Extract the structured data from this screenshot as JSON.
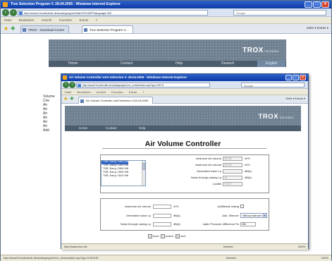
{
  "outer": {
    "title": "Trox Selection Program V. 28.04.2005 - Windows Internet Explorer",
    "address": "http://www2.troxtechnik.de/auslegung/en/StartYRV/APP/language=DE",
    "menu": [
      "Datei",
      "Bearbeiten",
      "Ansicht",
      "Favoriten",
      "Extras",
      "?"
    ],
    "tabs": [
      "TROX - Download Center",
      "Trox Selection Program V..."
    ],
    "toolbar_right": "Seite ▾  Extras ▾",
    "status_left": "http://www2.troxtechnik.de/auslegung/en/vvr_en/anwahle.asp?typ=VVR-E​/E",
    "status_zone": "Internet",
    "status_zoom": "100%"
  },
  "site": {
    "logo": "TROX",
    "logo_sub": "TECHNIK",
    "nav": [
      "Home",
      "Contact",
      "Help",
      "Deutsch",
      "English"
    ],
    "tree": [
      "Volume",
      "Cire",
      "Air",
      "Air",
      "Air",
      "Air",
      "Air",
      "Air",
      "Add"
    ]
  },
  "inner": {
    "title": "Air Volume Controller Unit Selection V. 28.04.2005 - Windows Internet Explorer",
    "address": "http://www2.troxtechnik.de/auslegung/en/vvr_en/selection.asp?typ=VVR-E",
    "menu": [
      "Datei",
      "Bearbeiten",
      "Ansicht",
      "Favoriten",
      "Extras",
      "?"
    ],
    "tab": "Air Volume Controller Unit Selection V.28.04.2005",
    "toolbar_right": "Seite ▾  Extras ▾",
    "status_left": "http://www.trox.de/",
    "status_zone": "Internet",
    "status_zoom": "100%",
    "nav": [
      "Home",
      "Contact",
      "Help"
    ]
  },
  "form": {
    "title": "Air Volume Controller",
    "list": [
      "TVR-Easy/100/00",
      "TVR-Easy/125/00",
      "TVR-Easy/160/00",
      "TVR-Easy/200/00",
      "TVR-Easy/250/00",
      "TVR-Easy/315/00"
    ],
    "list_selected_index": 0,
    "results": [
      {
        "label": "minimum Air volume",
        "value": "36.000",
        "unit": "m³/h"
      },
      {
        "label": "maximum Air volume",
        "value": "36.000",
        "unit": "m³/h"
      },
      {
        "label": "Generated noise Lp",
        "value": "",
        "unit": "dB(A)"
      },
      {
        "label": "Noise through casing Lp",
        "value": "46",
        "unit": "dB(A)"
      },
      {
        "label": "Leaflet",
        "value": "TVR-E",
        "unit": ""
      }
    ],
    "inputs_left": [
      {
        "label": "maximum Air volume",
        "unit": "m³/h"
      },
      {
        "label": "Generated noise Lp",
        "unit": "dB(A)"
      },
      {
        "label": "Noise through casing Lp",
        "unit": "dB(A)"
      }
    ],
    "additional_casing_label": "Additional casing",
    "add_silencer_label": "Add. Silencer",
    "add_silencer_value": "Without silencer",
    "pressure_label": "static Pressure difference Pa",
    "pressure_value": "250",
    "pager": [
      "back",
      "search",
      "next"
    ]
  }
}
